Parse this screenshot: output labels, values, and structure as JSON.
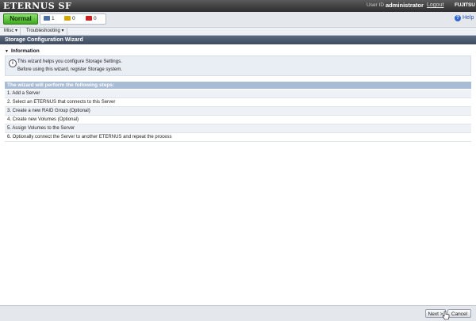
{
  "header": {
    "logo": "ETERNUS SF",
    "user_label": "User ID",
    "user_name": "administrator",
    "logout": "Logout",
    "brand": "FUJITSU"
  },
  "status": {
    "state": "Normal",
    "counts": [
      {
        "icon": "info-count-icon",
        "value": "1",
        "color": "#4a6fa5"
      },
      {
        "icon": "warning-count-icon",
        "value": "0",
        "color": "#d4a800"
      },
      {
        "icon": "error-count-icon",
        "value": "0",
        "color": "#cc2222"
      }
    ],
    "help": "Help"
  },
  "menu": [
    "Misc",
    "Troubleshooting"
  ],
  "panel_title": "Storage Configuration Wizard",
  "information": {
    "heading": "Information",
    "lines": [
      "This wizard helps you configure Storage Settings.",
      "Before using this wizard, register Storage system."
    ]
  },
  "steps": {
    "heading": "The wizard will perform the following steps:",
    "items": [
      "1. Add a Server",
      "2. Select an ETERNUS that connects to this Server",
      "3. Create a new RAID Group (Optional)",
      "4. Create new Volumes (Optional)",
      "5. Assign Volumes to the Server",
      "6. Optionally connect the Server to another ETERNUS and repeat the process"
    ]
  },
  "footer": {
    "next": "Next >",
    "cancel": "Cancel"
  }
}
